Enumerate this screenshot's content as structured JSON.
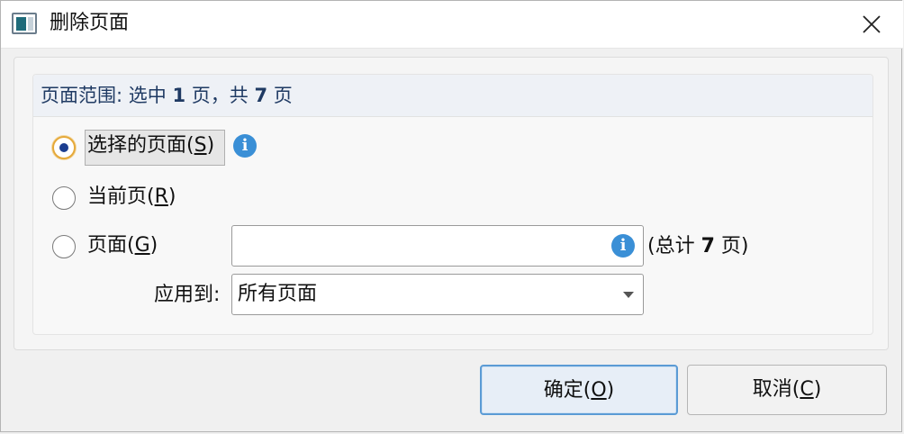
{
  "window": {
    "title": "删除页面"
  },
  "range": {
    "label": "页面范围: 选中",
    "selected": "1",
    "mid": "页，共",
    "total": "7",
    "end": "页"
  },
  "options": {
    "selected_pages": {
      "label": "选择的页面(",
      "key": "S",
      "close": ")"
    },
    "current_page": {
      "label": "当前页(",
      "key": "R",
      "close": ")"
    },
    "pages": {
      "label": "页面(",
      "key": "G",
      "close": ")"
    }
  },
  "pages_input": {
    "value": "",
    "placeholder": ""
  },
  "total_info": {
    "prefix": "(总计",
    "count": "7",
    "suffix": "页)"
  },
  "apply_to": {
    "label": "应用到:",
    "selected": "所有页面"
  },
  "buttons": {
    "ok": {
      "label": "确定(",
      "key": "O",
      "close": ")"
    },
    "cancel": {
      "label": "取消(",
      "key": "C",
      "close": ")"
    }
  },
  "icons": {
    "info": "info-icon",
    "close": "close-icon",
    "app": "app-icon",
    "dropdown": "chevron-down-icon"
  },
  "colors": {
    "accent": "#5b9bd5",
    "radio_dot": "#1b3d8f",
    "radio_focus": "#e5a93a",
    "info": "#3a8fd6"
  }
}
